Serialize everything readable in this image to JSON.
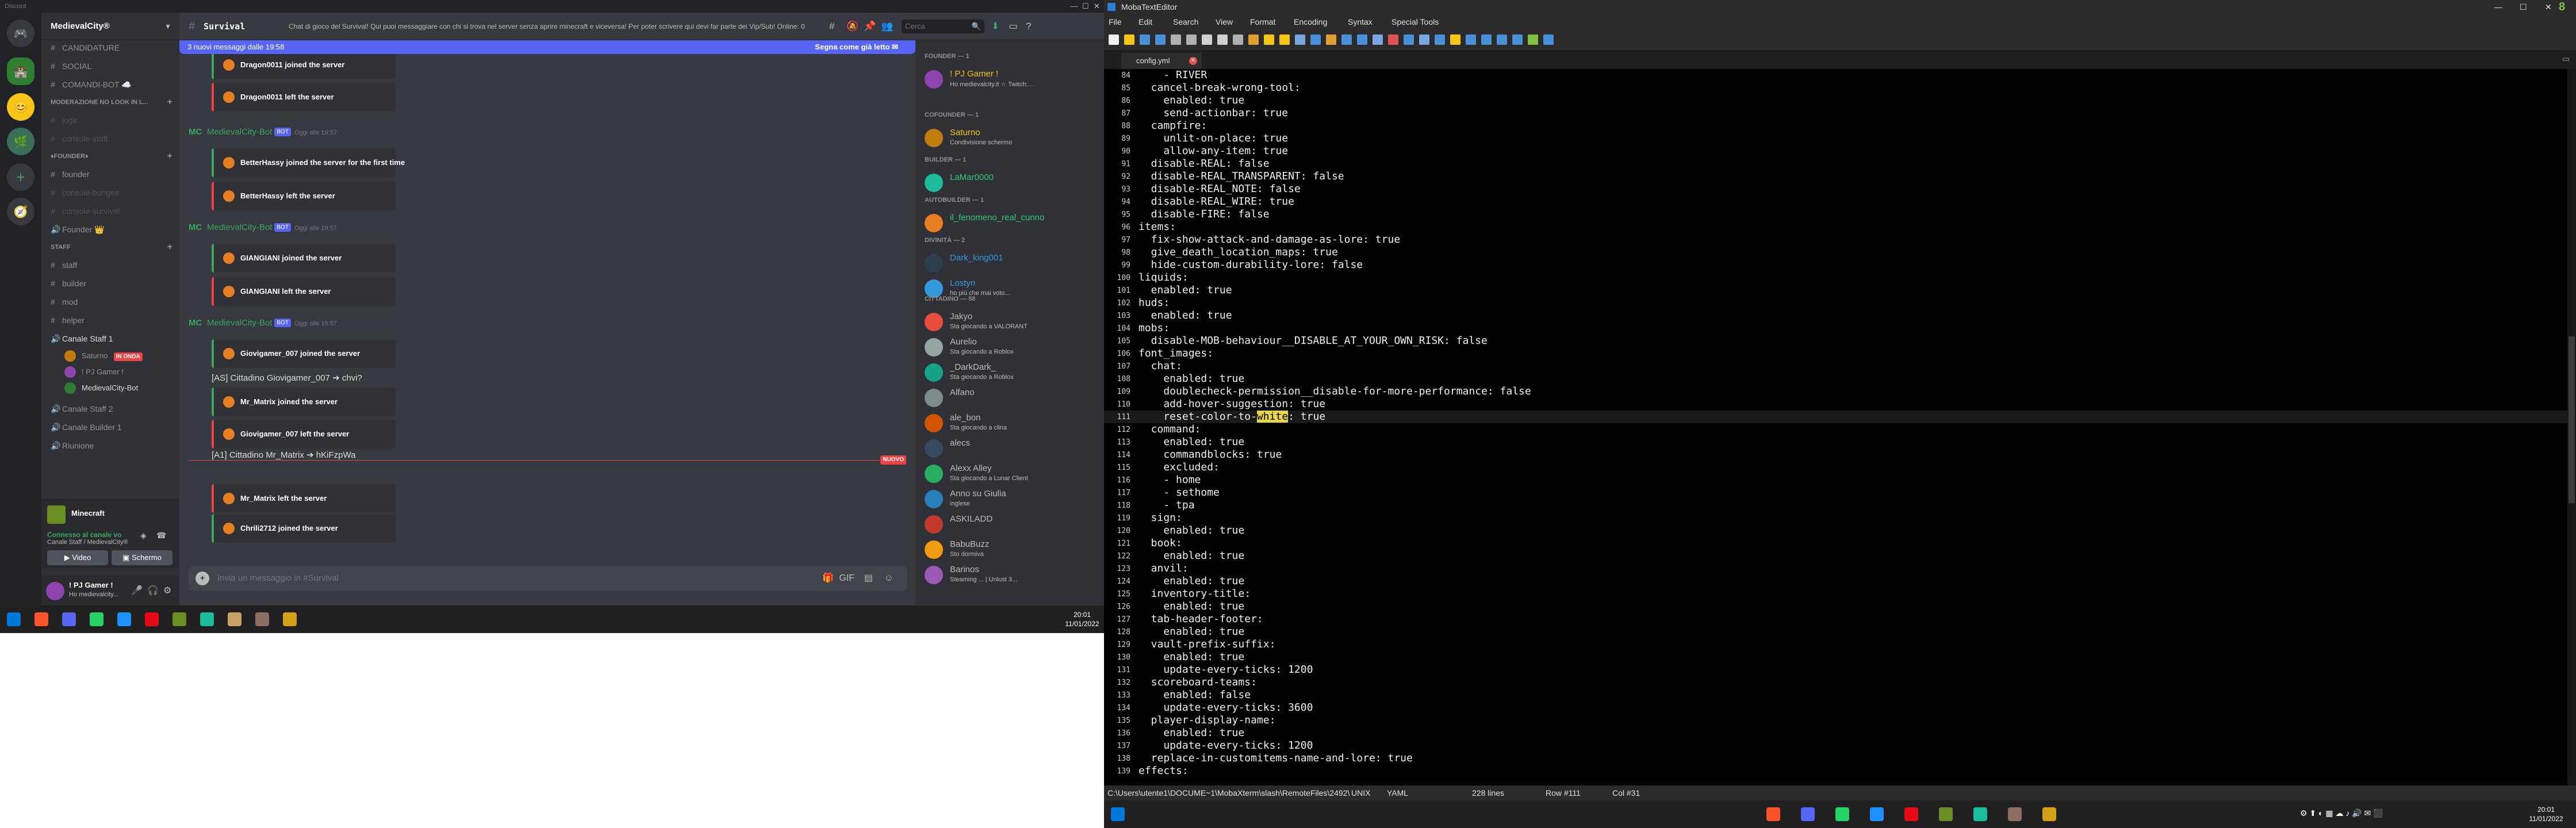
{
  "discord": {
    "app_title": "Discord",
    "server_name": "MedievalCity®",
    "channels": [
      {
        "label": "CANDIDATURE",
        "dim": false
      },
      {
        "label": "SOCIAL",
        "dim": false
      },
      {
        "label": "COMANDI-BOT ☁️",
        "dim": false
      },
      {
        "label": "logs",
        "dim": true
      },
      {
        "label": "console-staff",
        "dim": true
      }
    ],
    "category_moderation": "MODERAZIONE NO LOOK IN L...",
    "category_founder": "♦Founder♦",
    "founder_channels": [
      {
        "label": "founder",
        "dim": false
      },
      {
        "label": "console-bungee",
        "dim": true
      },
      {
        "label": "console-survival",
        "dim": true
      },
      {
        "label": "Founder 👑",
        "dim": false
      }
    ],
    "category_staff": "Staff",
    "staff_channels": [
      {
        "label": "staff"
      },
      {
        "label": "builder"
      },
      {
        "label": "mod"
      },
      {
        "label": "helper"
      }
    ],
    "voice_channel_staff": "Canale Staff",
    "voice_staff_count": "1",
    "voice_users": [
      {
        "name": "Saturno",
        "badge": "IN ONDA"
      },
      {
        "name": "! PJ Gamer !",
        "badge": ""
      },
      {
        "name": "MedievalCity-Bot",
        "badge": ""
      }
    ],
    "voice_channel_staff2": "Canale Staff",
    "voice_staff2_count": "2",
    "voice_channel_builder": "Canale Builder",
    "voice_builder_count": "1",
    "voice_riunione": "Riunione",
    "minecraft_label": "Minecraft",
    "vc_connected": "Connesso al canale vo",
    "vc_channel": "Canale Staff / MedievalCity®",
    "video_label": "Video",
    "screen_label": "Schermo",
    "me_name": "! PJ Gamer !",
    "me_status": "Ho medievalcity...",
    "channel_name": "Survival",
    "channel_topic": "Chat di gioco del Survival! Qui puoi messaggiare con chi si trova nel server senza aprire minecraft e viceversa! Per poter scrivere qui devi far parte dei Vip/Sub! Online: 0",
    "search_placeholder": "Cerca",
    "new_messages_bar": "3 nuovi messaggi dalle 19:58",
    "mark_read": "Segna come già letto",
    "bot_name": "MedievalCity-Bot",
    "bot_tag": "BOT",
    "bot_timestamp": "Oggi alle 19:57",
    "logo_short": "MC",
    "messages": [
      {
        "type": "embed",
        "color": "green",
        "text": "Dragon0011 joined the server"
      },
      {
        "type": "embed",
        "color": "red",
        "text": "Dragon0011 left the server"
      },
      {
        "type": "header"
      },
      {
        "type": "embed",
        "color": "green",
        "text": "BetterHassy joined the server for the first time"
      },
      {
        "type": "embed",
        "color": "red",
        "text": "BetterHassy left the server"
      },
      {
        "type": "header"
      },
      {
        "type": "embed",
        "color": "green",
        "text": "GIANGIANI joined the server"
      },
      {
        "type": "embed",
        "color": "red",
        "text": "GIANGIANI left the server"
      },
      {
        "type": "header"
      },
      {
        "type": "embed",
        "color": "green",
        "text": "Giovigamer_007 joined the server"
      },
      {
        "type": "plain",
        "text": "[AS] Cittadino Giovigamer_007 ➔ chvi?"
      },
      {
        "type": "embed",
        "color": "green",
        "text": "Mr_Matrix joined the server"
      },
      {
        "type": "embed",
        "color": "red",
        "text": "Giovigamer_007 left the server"
      },
      {
        "type": "plain",
        "text": "[A1] Cittadino Mr_Matrix ➔ hKiFzpWa"
      },
      {
        "type": "embed",
        "color": "red",
        "text": "Mr_Matrix left the server"
      },
      {
        "type": "embed",
        "color": "green",
        "text": "Chrili2712 joined the server"
      }
    ],
    "new_label": "NUOVO",
    "message_placeholder": "Invia un messaggio in #Survival",
    "member_categories": {
      "founder": "FOUNDER — 1",
      "cofounder": "COFOUNDER — 1",
      "builder": "BUILDER — 1",
      "autobuilder": "AUTOBUILDER — 1",
      "divinita": "DIVINITÀ — 2",
      "cittadino": "CITTADINO — 58"
    },
    "members": [
      {
        "name": "! PJ Gamer !",
        "status": "Ho medievalcity.it ☆ Twitch:...",
        "color": "#f1c40f",
        "group": "founder"
      },
      {
        "name": "Saturno",
        "status": "Condivisione schermo",
        "color": "#f1c40f",
        "group": "cofounder"
      },
      {
        "name": "LaMar0000",
        "status": "",
        "color": "#2ecc71",
        "group": "builder"
      },
      {
        "name": "il_fenomeno_real_cunno",
        "status": "",
        "color": "#2ecc71",
        "group": "autobuilder"
      },
      {
        "name": "Dark_king001",
        "status": "",
        "color": "#3498db",
        "group": "divinita"
      },
      {
        "name": "Lostyn",
        "status": "ho più che mai voto...",
        "color": "#3498db",
        "group": "divinita"
      },
      {
        "name": "Jakyo",
        "status": "Sta giocando a VALORANT",
        "color": "#b9bbbe",
        "group": "cittadino"
      },
      {
        "name": "Aurelio",
        "status": "Sta giocando a Roblox",
        "color": "#b9bbbe",
        "group": "cittadino"
      },
      {
        "name": "_DarkDark_",
        "status": "Sta giocando a Roblox",
        "color": "#b9bbbe",
        "group": "cittadino"
      },
      {
        "name": "Alfano",
        "status": "",
        "color": "#b9bbbe",
        "group": "cittadino"
      },
      {
        "name": "ale_bon",
        "status": "Sta giocando a clina",
        "color": "#b9bbbe",
        "group": "cittadino"
      },
      {
        "name": "alecs",
        "status": "",
        "color": "#b9bbbe",
        "group": "cittadino"
      },
      {
        "name": "Alexx Alley",
        "status": "Sta giocando a Lunar Client",
        "color": "#b9bbbe",
        "group": "cittadino"
      },
      {
        "name": "Anno su Giulia",
        "status": "inglese",
        "color": "#b9bbbe",
        "group": "cittadino"
      },
      {
        "name": "ASKILADD",
        "status": "",
        "color": "#b9bbbe",
        "group": "cittadino"
      },
      {
        "name": "BabuBuzz",
        "status": "Sto dormiva",
        "color": "#b9bbbe",
        "group": "cittadino"
      },
      {
        "name": "Barinos",
        "status": "Steaming ... | Unlust 3...",
        "color": "#b9bbbe",
        "group": "cittadino"
      }
    ]
  },
  "taskbar_left": {
    "time": "20:01",
    "date": "11/01/2022"
  },
  "taskbar_right": {
    "time": "20:01",
    "date": "11/01/2022"
  },
  "editor": {
    "app_title": "MobaTextEditor",
    "menu": [
      "File",
      "Edit",
      "Search",
      "View",
      "Format",
      "Encoding",
      "Syntax",
      "Special Tools"
    ],
    "tab_name": "config.yml",
    "highlight_line": 111,
    "highlight_word": "white",
    "lines": [
      {
        "n": 84,
        "t": "    - RIVER"
      },
      {
        "n": 85,
        "t": "  cancel-break-wrong-tool:"
      },
      {
        "n": 86,
        "t": "    enabled: true"
      },
      {
        "n": 87,
        "t": "    send-actionbar: true"
      },
      {
        "n": 88,
        "t": "  campfire:"
      },
      {
        "n": 89,
        "t": "    unlit-on-place: true"
      },
      {
        "n": 90,
        "t": "    allow-any-item: true"
      },
      {
        "n": 91,
        "t": "  disable-REAL: false"
      },
      {
        "n": 92,
        "t": "  disable-REAL_TRANSPARENT: false"
      },
      {
        "n": 93,
        "t": "  disable-REAL_NOTE: false"
      },
      {
        "n": 94,
        "t": "  disable-REAL_WIRE: true"
      },
      {
        "n": 95,
        "t": "  disable-FIRE: false"
      },
      {
        "n": 96,
        "t": "items:"
      },
      {
        "n": 97,
        "t": "  fix-show-attack-and-damage-as-lore: true"
      },
      {
        "n": 98,
        "t": "  give_death_location_maps: true"
      },
      {
        "n": 99,
        "t": "  hide-custom-durability-lore: false"
      },
      {
        "n": 100,
        "t": "liquids:"
      },
      {
        "n": 101,
        "t": "  enabled: true"
      },
      {
        "n": 102,
        "t": "huds:"
      },
      {
        "n": 103,
        "t": "  enabled: true"
      },
      {
        "n": 104,
        "t": "mobs:"
      },
      {
        "n": 105,
        "t": "  disable-MOB-behaviour__DISABLE_AT_YOUR_OWN_RISK: false"
      },
      {
        "n": 106,
        "t": "font_images:"
      },
      {
        "n": 107,
        "t": "  chat:"
      },
      {
        "n": 108,
        "t": "    enabled: true"
      },
      {
        "n": 109,
        "t": "    doublecheck-permission__disable-for-more-performance: false"
      },
      {
        "n": 110,
        "t": "    add-hover-suggestion: true"
      },
      {
        "n": 111,
        "t": "    reset-color-to-white: true"
      },
      {
        "n": 112,
        "t": "  command:"
      },
      {
        "n": 113,
        "t": "    enabled: true"
      },
      {
        "n": 114,
        "t": "    commandblocks: true"
      },
      {
        "n": 115,
        "t": "    excluded:"
      },
      {
        "n": 116,
        "t": "    - home"
      },
      {
        "n": 117,
        "t": "    - sethome"
      },
      {
        "n": 118,
        "t": "    - tpa"
      },
      {
        "n": 119,
        "t": "  sign:"
      },
      {
        "n": 120,
        "t": "    enabled: true"
      },
      {
        "n": 121,
        "t": "  book:"
      },
      {
        "n": 122,
        "t": "    enabled: true"
      },
      {
        "n": 123,
        "t": "  anvil:"
      },
      {
        "n": 124,
        "t": "    enabled: true"
      },
      {
        "n": 125,
        "t": "  inventory-title:"
      },
      {
        "n": 126,
        "t": "    enabled: true"
      },
      {
        "n": 127,
        "t": "  tab-header-footer:"
      },
      {
        "n": 128,
        "t": "    enabled: true"
      },
      {
        "n": 129,
        "t": "  vault-prefix-suffix:"
      },
      {
        "n": 130,
        "t": "    enabled: true"
      },
      {
        "n": 131,
        "t": "    update-every-ticks: 1200"
      },
      {
        "n": 132,
        "t": "  scoreboard-teams:"
      },
      {
        "n": 133,
        "t": "    enabled: false"
      },
      {
        "n": 134,
        "t": "    update-every-ticks: 3600"
      },
      {
        "n": 135,
        "t": "  player-display-name:"
      },
      {
        "n": 136,
        "t": "    enabled: true"
      },
      {
        "n": 137,
        "t": "    update-every-ticks: 1200"
      },
      {
        "n": 138,
        "t": "  replace-in-customitems-name-and-lore: true"
      },
      {
        "n": 139,
        "t": "effects:"
      }
    ],
    "status": {
      "path": "C:\\Users\\utente1\\DOCUME~1\\MobaXterm\\slash\\RemoteFiles\\2492\\",
      "eol": "UNIX",
      "syntax": "YAML",
      "lines": "228 lines",
      "row": "Row #111",
      "col": "Col #31"
    }
  }
}
